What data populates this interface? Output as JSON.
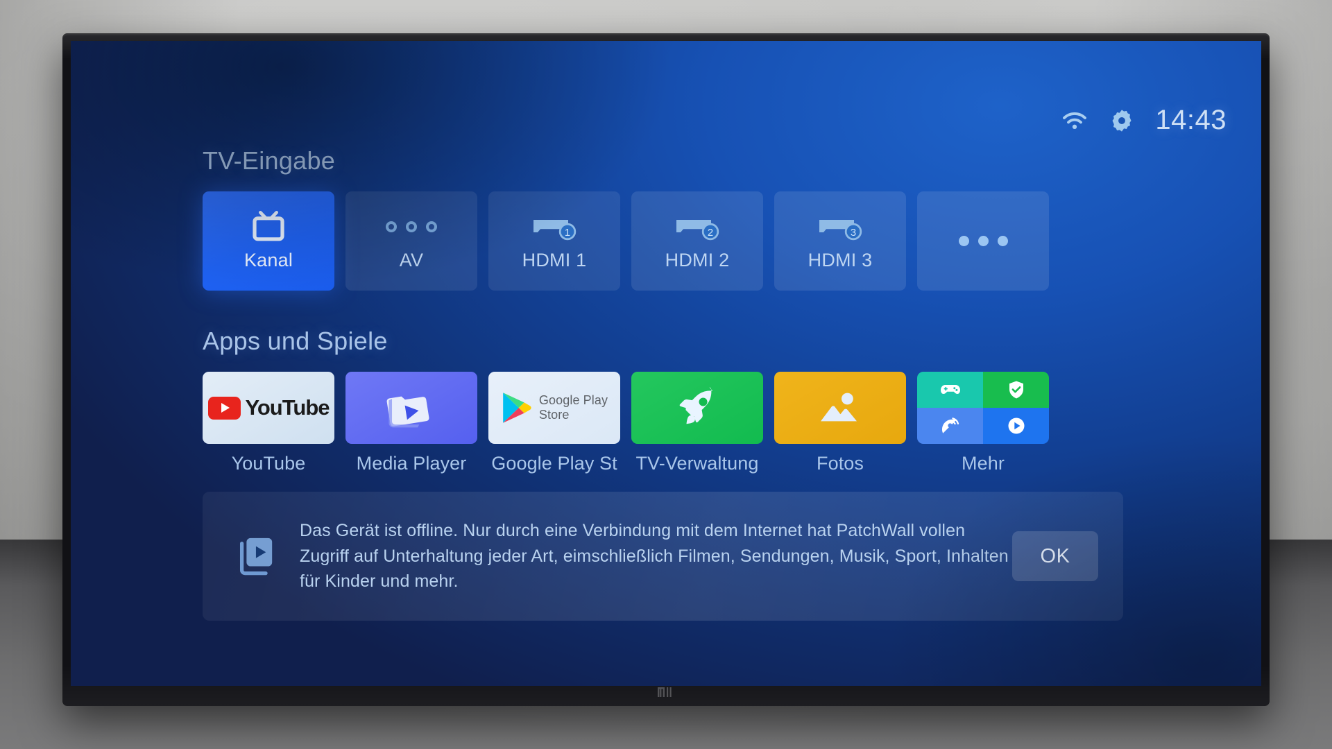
{
  "status_bar": {
    "wifi_icon": "wifi-icon",
    "settings_icon": "gear-icon",
    "time": "14:43"
  },
  "tv_input": {
    "title": "TV-Eingabe",
    "tiles": [
      {
        "label": "Kanal",
        "icon": "tv-icon",
        "selected": true
      },
      {
        "label": "AV",
        "icon": "av-dots-icon",
        "selected": false
      },
      {
        "label": "HDMI 1",
        "icon": "hdmi-connector-icon",
        "badge": "1",
        "selected": false
      },
      {
        "label": "HDMI 2",
        "icon": "hdmi-connector-icon",
        "badge": "2",
        "selected": false
      },
      {
        "label": "HDMI 3",
        "icon": "hdmi-connector-icon",
        "badge": "3",
        "selected": false
      },
      {
        "label": "",
        "icon": "more-dots-icon",
        "selected": false
      }
    ]
  },
  "apps": {
    "title": "Apps und Spiele",
    "items": [
      {
        "label": "YouTube",
        "icon": "youtube-icon",
        "brand_text": "YouTube"
      },
      {
        "label": "Media Player",
        "icon": "media-folder-icon"
      },
      {
        "label": "Google Play St",
        "icon": "google-play-icon",
        "brand_line1": "Google Play",
        "brand_line2": "Store"
      },
      {
        "label": "TV-Verwaltung",
        "icon": "rocket-icon"
      },
      {
        "label": "Fotos",
        "icon": "photo-icon"
      },
      {
        "label": "Mehr",
        "icon": "more-grid-icon",
        "quadrants": [
          "gamepad-icon",
          "shield-check-icon",
          "satellite-dish-icon",
          "play-circle-icon"
        ]
      }
    ]
  },
  "notification": {
    "icon": "video-library-icon",
    "message": "Das Gerät ist offline. Nur durch eine Verbindung mit dem Internet hat PatchWall vollen Zugriff auf Unterhaltung jeder Art, eimschließlich Filmen, Sendungen, Musik, Sport, Inhalten für Kinder und mehr.",
    "ok_label": "OK"
  },
  "device": {
    "brand_logo": "mi-logo"
  },
  "colors": {
    "accent_selected": "#1f62f2",
    "media_player": "#5560ef",
    "tv_management": "#12bb4f",
    "fotos": "#e7a80e",
    "youtube_red": "#e8241d",
    "quad_teal": "#19c8ad",
    "quad_green": "#18bd4e",
    "quad_blue_light": "#4b86ef",
    "quad_blue": "#1e74ef"
  }
}
